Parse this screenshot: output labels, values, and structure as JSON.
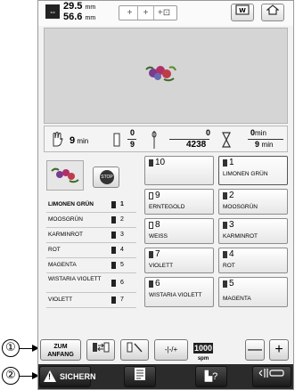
{
  "callouts": [
    {
      "label": "①"
    },
    {
      "label": "②"
    }
  ],
  "topbar": {
    "size_width": "29.5",
    "size_height": "56.6",
    "unit": "mm",
    "zoom_icons": [
      "zoom-in-icon",
      "zoom-in-more-icon",
      "zoom-in-max-icon"
    ],
    "view_icon": "view-icon",
    "home_icon": "home-icon"
  },
  "status": {
    "hand_time": "9",
    "time_unit": "min",
    "color_fraction_top": "0",
    "color_fraction_bottom": "9",
    "stitch_top": "0",
    "stitch_bottom": "4238",
    "remaining_top": "0",
    "remaining_top_unit": "min",
    "remaining_bottom": "9",
    "remaining_bottom_unit": "min"
  },
  "thread_list": [
    {
      "name": "LIMONEN GRÜN",
      "num": "1"
    },
    {
      "name": "MOOSGRÜN",
      "num": "2"
    },
    {
      "name": "KARMINROT",
      "num": "3"
    },
    {
      "name": "ROT",
      "num": "4"
    },
    {
      "name": "MAGENTA",
      "num": "5"
    },
    {
      "name": "WISTARIA VIOLETT",
      "num": "6"
    },
    {
      "name": "VIOLETT",
      "num": "7"
    }
  ],
  "spools": [
    {
      "num": "10",
      "name": "",
      "hollow": false
    },
    {
      "num": "1",
      "name": "LIMONEN GRÜN",
      "hollow": false
    },
    {
      "num": "9",
      "name": "ERNTEGOLD",
      "hollow": true
    },
    {
      "num": "2",
      "name": "MOOSGRÜN",
      "hollow": false
    },
    {
      "num": "8",
      "name": "WEISS",
      "hollow": true
    },
    {
      "num": "3",
      "name": "KARMINROT",
      "hollow": false
    },
    {
      "num": "7",
      "name": "VIOLETT",
      "hollow": false
    },
    {
      "num": "4",
      "name": "ROT",
      "hollow": false
    },
    {
      "num": "6",
      "name": "WISTARIA VIOLETT",
      "hollow": false
    },
    {
      "num": "5",
      "name": "MAGENTA",
      "hollow": false
    }
  ],
  "toolbar": {
    "zum_line1": "ZUM",
    "zum_line2": "ANFANG",
    "tension_label": "-|-/+",
    "speed_value": "1000",
    "speed_unit": "spm",
    "minus_label": "—",
    "plus_label": "+"
  },
  "bottombar": {
    "sichern_label": "SICHERN",
    "warning_glyph": "!",
    "help_label": "?"
  }
}
